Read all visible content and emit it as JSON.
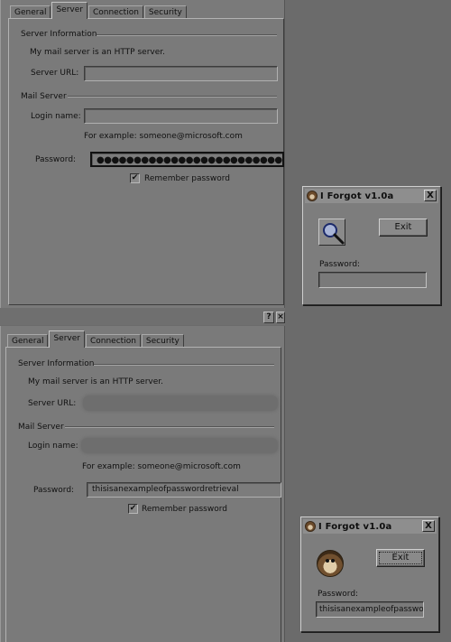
{
  "top_panel": {
    "tabs": [
      "General",
      "Server",
      "Connection",
      "Security"
    ],
    "active_tab": "Server",
    "server_info_title": "Server Information",
    "http_note": "My mail server is an HTTP server.",
    "server_url_label": "Server URL:",
    "server_url_value": "",
    "mail_server_title": "Mail Server",
    "login_label": "Login name:",
    "login_value": "",
    "example_text": "For example: someone@microsoft.com",
    "password_label": "Password:",
    "password_masked": "●●●●●●●●●●●●●●●●●●●●●●●●●●●●●●●●●●●●●●●●●",
    "remember_label": "Remember password",
    "remember_checked": true
  },
  "strip": {
    "help_button": "?"
  },
  "bottom_panel": {
    "tabs": [
      "General",
      "Server",
      "Connection",
      "Security"
    ],
    "active_tab": "Server",
    "server_info_title": "Server Information",
    "http_note": "My mail server is an HTTP server.",
    "server_url_label": "Server URL:",
    "mail_server_title": "Mail Server",
    "login_label": "Login name:",
    "example_text": "For example: someone@microsoft.com",
    "password_label": "Password:",
    "password_value": "thisisanexampleofpasswordretrieval",
    "remember_label": "Remember password",
    "remember_checked": true
  },
  "iforgot_top": {
    "title": "I Forgot v1.0a",
    "close": "X",
    "exit_label": "Exit",
    "password_label": "Password:",
    "password_value": "",
    "icon": "magnifier-icon"
  },
  "iforgot_bottom": {
    "title": "I Forgot v1.0a",
    "close": "X",
    "exit_label": "Exit",
    "password_label": "Password:",
    "password_value": "thisisanexampleofpasswordretrieval",
    "icon": "monkey-icon"
  },
  "colors": {
    "panel_bg": "#7a7a7a",
    "desktop_bg": "#6b6b6b",
    "mini_bg": "#7d7d7d"
  }
}
